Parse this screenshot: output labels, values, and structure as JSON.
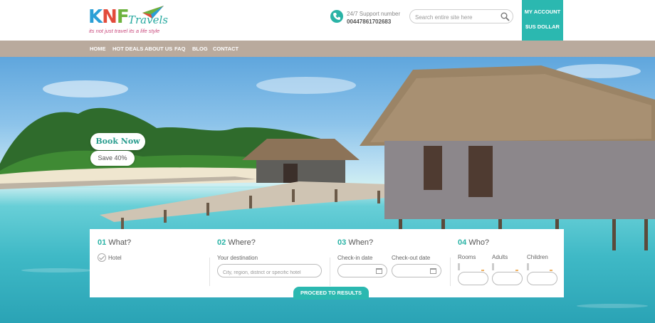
{
  "brand": {
    "logo_letters": [
      "K",
      "N",
      "F"
    ],
    "logo_word": "Travels",
    "tagline": "its not just travel its a life style",
    "colors": {
      "k": "#2a9fd6",
      "n": "#e24b3b",
      "f": "#6cb33e",
      "accent": "#2bb8b0"
    }
  },
  "support": {
    "label": "24/7 Support number",
    "number": "00447861702683",
    "icon": "phone-icon"
  },
  "search": {
    "placeholder": "Search entire site here",
    "icon": "search-icon"
  },
  "account": {
    "my_account": "MY ACCOUNT",
    "currency": "$US DOLLAR"
  },
  "nav": {
    "items": [
      "HOME",
      "HOT DEALS",
      "ABOUT US",
      "FAQ",
      "BLOG",
      "CONTACT"
    ]
  },
  "hero": {
    "book_now": "Book Now",
    "save": "Save 40%"
  },
  "booking": {
    "what": {
      "num": "01",
      "title": "What?",
      "option": "Hotel"
    },
    "where": {
      "num": "02",
      "title": "Where?",
      "label": "Your destination",
      "placeholder": "City, region, district or specific hotel"
    },
    "when": {
      "num": "03",
      "title": "When?",
      "checkin": "Check-in date",
      "checkout": "Check-out date"
    },
    "who": {
      "num": "04",
      "title": "Who?",
      "rooms": "Rooms",
      "adults": "Adults",
      "children": "Children"
    },
    "proceed": "PROCEED TO RESULTS"
  }
}
